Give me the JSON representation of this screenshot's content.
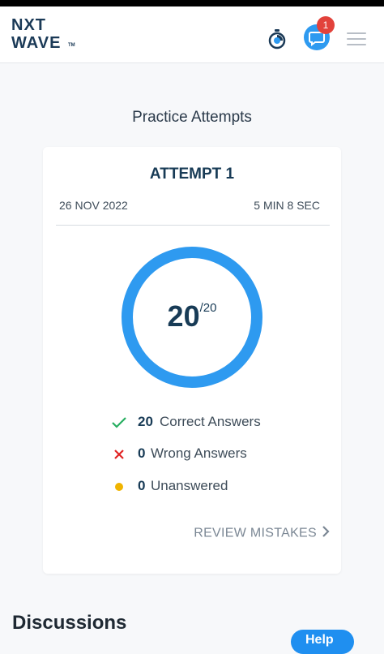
{
  "header": {
    "logo_line1": "NXT",
    "logo_line2": "WAVE",
    "logo_tm": "TM",
    "notification_count": "1",
    "icons": [
      "timer-icon",
      "chat-icon",
      "hamburger-menu-icon"
    ]
  },
  "section_title": "Practice Attempts",
  "attempt": {
    "title": "ATTEMPT 1",
    "date": "26 NOV 2022",
    "duration": "5 MIN 8 SEC",
    "score": "20",
    "total": "/20",
    "progress_fraction": 1.0,
    "stats": {
      "correct": {
        "value": "20",
        "label": "Correct Answers"
      },
      "wrong": {
        "value": "0",
        "label": "Wrong Answers"
      },
      "unanswered": {
        "value": "0",
        "label": "Unanswered"
      }
    },
    "review_label": "REVIEW MISTAKES"
  },
  "discussions_title": "Discussions",
  "help_label": "Help",
  "colors": {
    "ring": "#2e9af0",
    "correct": "#27ae60",
    "wrong": "#e02424",
    "unanswered": "#f0b400",
    "primary_text": "#183b56"
  }
}
